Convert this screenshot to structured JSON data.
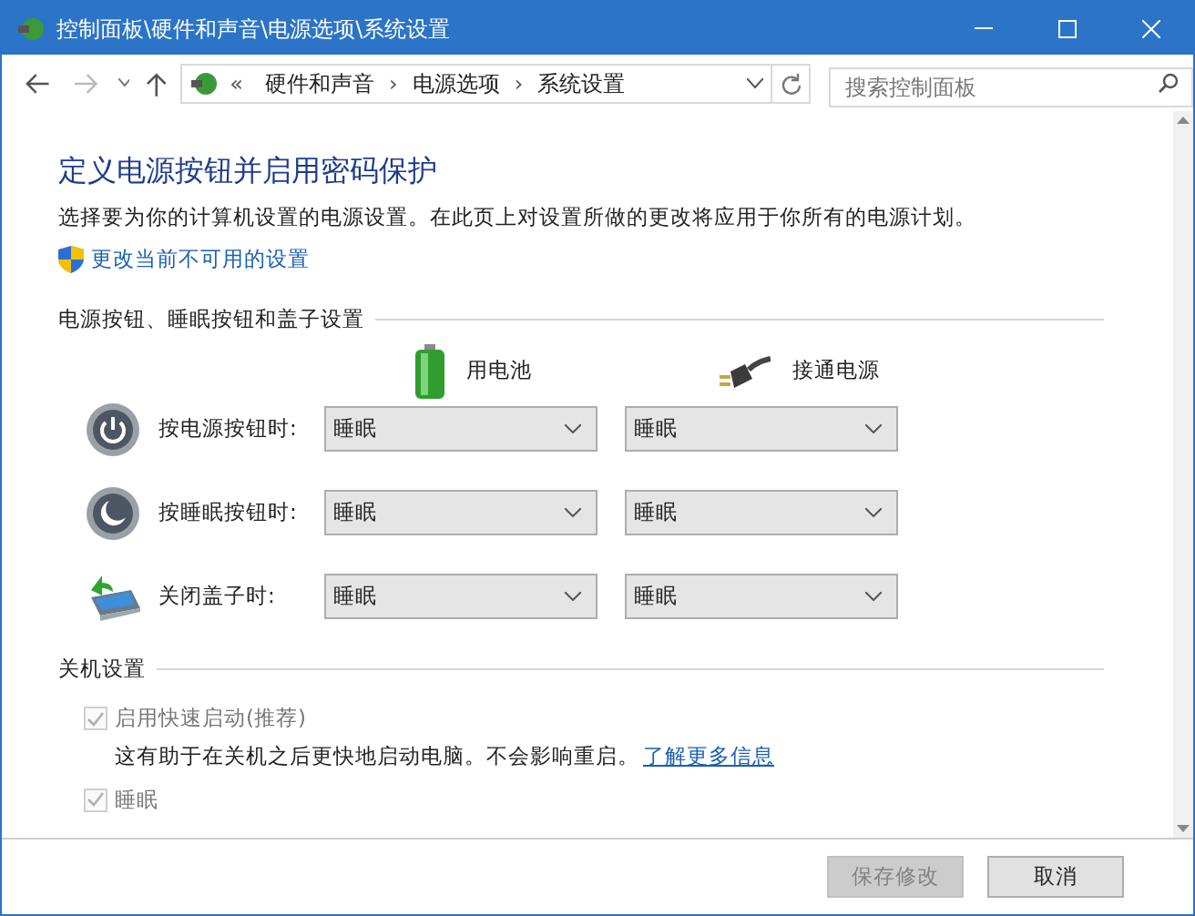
{
  "window": {
    "title": "控制面板\\硬件和声音\\电源选项\\系统设置"
  },
  "address_bar": {
    "prefix": "«",
    "crumbs": [
      "硬件和声音",
      "电源选项",
      "系统设置"
    ],
    "separator": "›"
  },
  "search": {
    "placeholder": "搜索控制面板"
  },
  "heading": "定义电源按钮并启用密码保护",
  "description": "选择要为你的计算机设置的电源设置。在此页上对设置所做的更改将应用于你所有的电源计划。",
  "admin_link": "更改当前不可用的设置",
  "power_section": {
    "title": "电源按钮、睡眠按钮和盖子设置",
    "columns": [
      {
        "kind": "battery",
        "label": "用电池"
      },
      {
        "kind": "plug",
        "label": "接通电源"
      }
    ],
    "rows": [
      {
        "kind": "power",
        "label": "按电源按钮时:",
        "values": [
          "睡眠",
          "睡眠"
        ]
      },
      {
        "kind": "sleep",
        "label": "按睡眠按钮时:",
        "values": [
          "睡眠",
          "睡眠"
        ]
      },
      {
        "kind": "lid",
        "label": "关闭盖子时:",
        "values": [
          "睡眠",
          "睡眠"
        ]
      }
    ]
  },
  "shutdown_section": {
    "title": "关机设置",
    "options": [
      {
        "label": "启用快速启动(推荐)",
        "checked": true,
        "disabled": true,
        "note": "这有助于在关机之后更快地启动电脑。不会影响重启。",
        "link": "了解更多信息"
      },
      {
        "label": "睡眠",
        "checked": true,
        "disabled": true
      }
    ]
  },
  "buttons": [
    {
      "label": "保存修改",
      "disabled": true
    },
    {
      "label": "取消",
      "disabled": false
    }
  ]
}
